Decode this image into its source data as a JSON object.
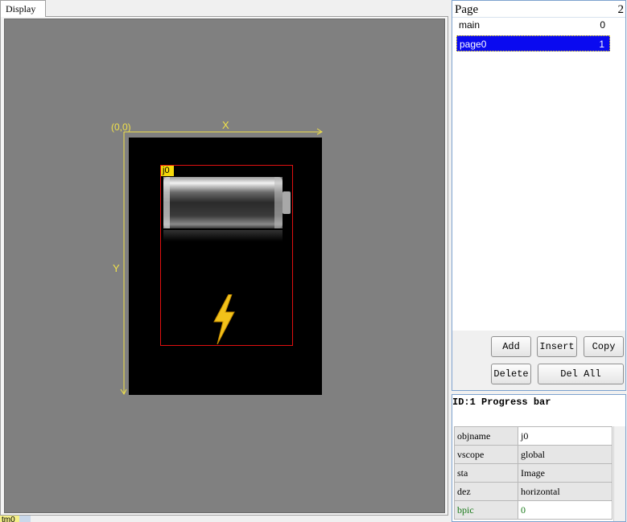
{
  "display": {
    "tab_label": "Display",
    "origin_label": "(0,0)",
    "x_axis_label": "X",
    "y_axis_label": "Y",
    "object_tag": "j0",
    "bottom_tag": "tm0",
    "colors": {
      "axis": "#f0e14a",
      "canvas": "#808080",
      "screen": "#000000",
      "selection": "#e01010"
    }
  },
  "page_panel": {
    "title": "Page",
    "count": "2",
    "pages": [
      {
        "name": "main",
        "index": "0",
        "selected": false
      },
      {
        "name": "page0",
        "index": "1",
        "selected": true
      }
    ],
    "buttons": {
      "add": "Add",
      "insert": "Insert",
      "copy": "Copy",
      "delete": "Delete",
      "del_all": "Del All"
    }
  },
  "property_panel": {
    "title": "ID:1 Progress bar",
    "rows": [
      {
        "key": "objname",
        "value": "j0"
      },
      {
        "key": "vscope",
        "value": "global"
      },
      {
        "key": "sta",
        "value": "Image"
      },
      {
        "key": "dez",
        "value": "horizontal"
      },
      {
        "key": "bpic",
        "value": "0"
      }
    ]
  }
}
